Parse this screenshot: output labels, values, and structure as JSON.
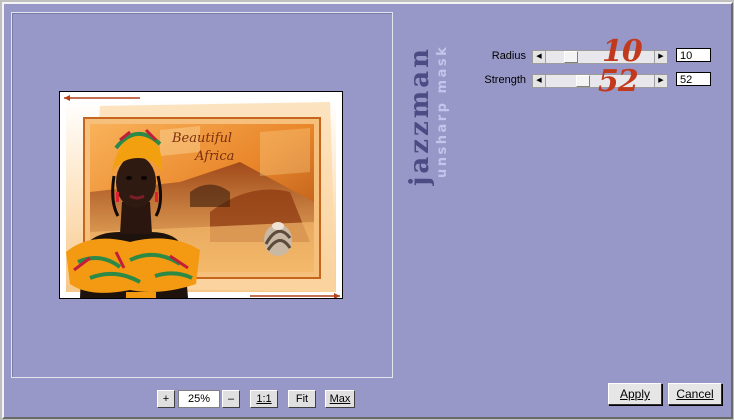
{
  "preview": {
    "zoom": "25%",
    "zoom_in": "+",
    "zoom_out": "–",
    "one_to_one": "1:1",
    "fit": "Fit",
    "max": "Max"
  },
  "brand": {
    "name": "jazzman",
    "plugin": "unsharp mask"
  },
  "image": {
    "caption_line1": "Beautiful",
    "caption_line2": "Africa"
  },
  "controls": [
    {
      "label": "Radius",
      "value": "10",
      "display": "10",
      "fraction": 0.2
    },
    {
      "label": "Strength",
      "value": "52",
      "display": "52",
      "fraction": 0.32
    }
  ],
  "buttons": {
    "apply": "Apply",
    "cancel": "Cancel"
  }
}
